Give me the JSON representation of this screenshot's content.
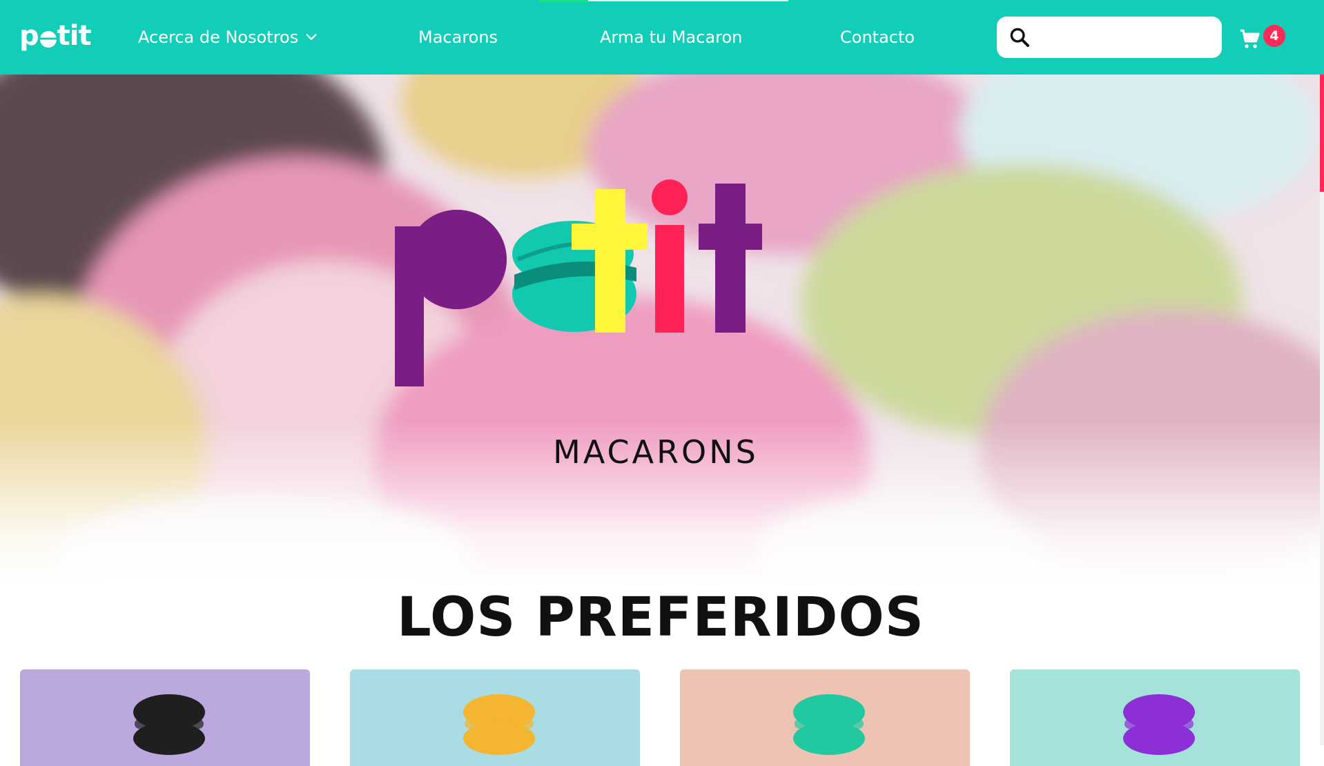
{
  "navbar": {
    "brand": "petit",
    "links": [
      {
        "label": "Acerca de Nosotros"
      },
      {
        "label": "Macarons"
      },
      {
        "label": "Arma tu Macaron"
      },
      {
        "label": "Contacto"
      }
    ],
    "search": {
      "placeholder": "",
      "value": ""
    },
    "cart": {
      "count": "4"
    }
  },
  "hero": {
    "logo_text": "petit",
    "subtitle": "MACARONS"
  },
  "favorites": {
    "title": "LOS PREFERIDOS",
    "cards": [
      {
        "macaron_color": "#1f1f1f",
        "background": "#bba8df"
      },
      {
        "macaron_color": "#f4b531",
        "background": "#a9dde3"
      },
      {
        "macaron_color": "#22c9a0",
        "background": "#eec3b4"
      },
      {
        "macaron_color": "#8d2fd6",
        "background": "#a5e2da"
      }
    ]
  },
  "colors": {
    "nav_background": "#12cdb8",
    "badge": "#ff2a57",
    "logo_purple": "#7a1d85",
    "logo_teal": "#12c9b0",
    "logo_yellow": "#fff53b",
    "logo_red": "#ff2257"
  },
  "icons": [
    "chevron-down-icon",
    "search-icon",
    "cart-icon"
  ]
}
